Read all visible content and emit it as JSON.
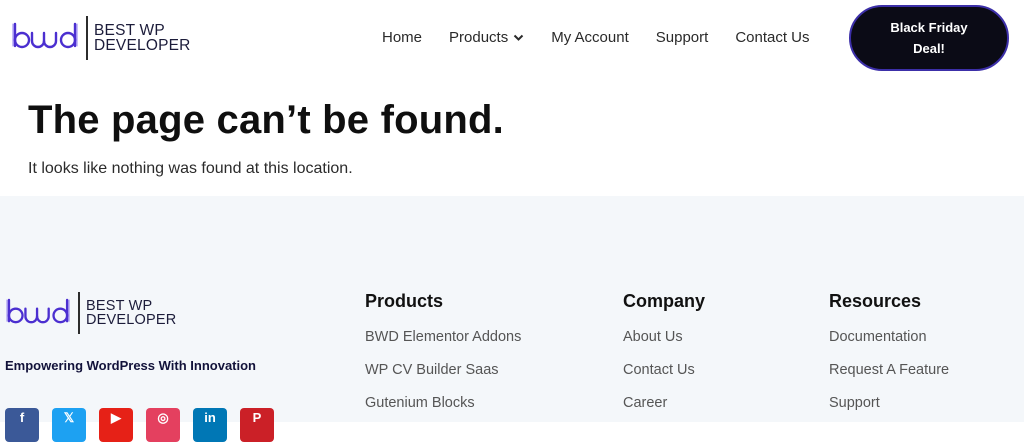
{
  "brand": {
    "mark": "bwd",
    "line1": "BEST WP",
    "line2": "DEVELOPER"
  },
  "nav": {
    "items": [
      {
        "label": "Home"
      },
      {
        "label": "Products",
        "has_dropdown": true
      },
      {
        "label": "My Account"
      },
      {
        "label": "Support"
      },
      {
        "label": "Contact Us"
      }
    ],
    "cta_line1": "Black Friday",
    "cta_line2": "Deal!"
  },
  "main": {
    "title": "The page can’t be found.",
    "description": "It looks like nothing was found at this location."
  },
  "footer": {
    "tagline": "Empowering WordPress With Innovation",
    "socials": [
      {
        "icon": "facebook-icon",
        "color": "#3b5998"
      },
      {
        "icon": "x-twitter-icon",
        "color": "#1da1f2"
      },
      {
        "icon": "youtube-icon",
        "color": "#e62117"
      },
      {
        "icon": "instagram-icon",
        "color": "#e4405f"
      },
      {
        "icon": "linkedin-icon",
        "color": "#0077b5"
      },
      {
        "icon": "pinterest-icon",
        "color": "#cb2027"
      }
    ],
    "columns": [
      {
        "heading": "Products",
        "links": [
          "BWD Elementor Addons",
          "WP CV Builder Saas",
          "Gutenium Blocks"
        ]
      },
      {
        "heading": "Company",
        "links": [
          "About Us",
          "Contact Us",
          "Career"
        ]
      },
      {
        "heading": "Resources",
        "links": [
          "Documentation",
          "Request A Feature",
          "Support"
        ]
      }
    ]
  },
  "colors": {
    "brand_purple": "#4b2fd0",
    "cta_bg": "#0b0b16",
    "cta_border": "#3c2fa8",
    "footer_bg": "#f4f7fa"
  }
}
